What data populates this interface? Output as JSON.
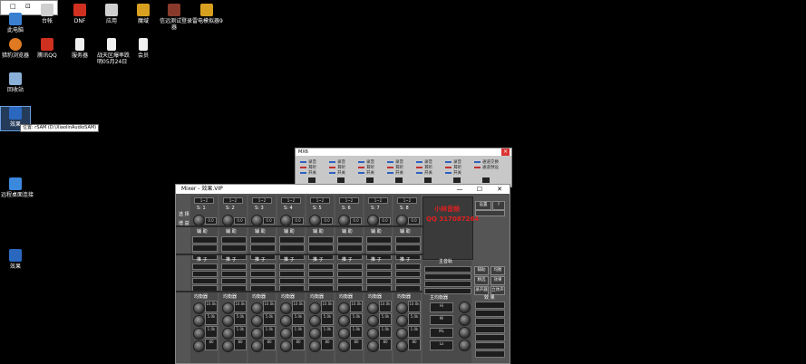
{
  "desktop_icons": [
    {
      "name": "此电脑",
      "line2": ""
    },
    {
      "name": "台帐",
      "line2": ""
    },
    {
      "name": "DNF",
      "line2": ""
    },
    {
      "name": "应用",
      "line2": ""
    },
    {
      "name": "魔域",
      "line2": ""
    },
    {
      "name": "信远测试登录",
      "line2": "器"
    },
    {
      "name": "雷电模拟器9",
      "line2": ""
    },
    {
      "name": "猎豹浏览器",
      "line2": ""
    },
    {
      "name": "腾讯QQ",
      "line2": ""
    },
    {
      "name": "服务器",
      "line2": ""
    },
    {
      "name": "战天区爆率跌",
      "line2": "明05月24日"
    },
    {
      "name": "会员",
      "line2": ""
    },
    {
      "name": "回收站",
      "line2": ""
    },
    {
      "name": "效果",
      "line2": ""
    },
    {
      "name": "远程桌面连接",
      "line2": ""
    },
    {
      "name": "效果",
      "line2": ""
    }
  ],
  "tooltip": "位置: rSAM (D:\\XiaolinAudioSAM)",
  "explorer_buttons": [
    "□",
    "⊡",
    "□"
  ],
  "mx6": {
    "title": "MX6",
    "close": "×",
    "items": [
      [
        "录音",
        "耳听",
        "开关"
      ],
      [
        "录音",
        "耳听",
        "开关"
      ],
      [
        "录音",
        "耳听",
        "开关"
      ],
      [
        "录音",
        "耳听",
        "开关"
      ],
      [
        "录音",
        "耳听",
        "开关"
      ],
      [
        "录音",
        "耳听",
        "开关"
      ],
      [
        "通道交换",
        "通道预设",
        ""
      ]
    ]
  },
  "mixer": {
    "title": "Mixer - 效果.VIP",
    "minimize": "—",
    "maximize": "☐",
    "close": "✕",
    "row_labels": [
      "选 择",
      "增 益"
    ],
    "channels": [
      "S: 1",
      "S: 2",
      "S: 3",
      "S: 4",
      "S: 5",
      "S: 6",
      "S: 7",
      "S: 8"
    ],
    "gain_value": "0.0",
    "aux_label": "辅 助",
    "comp_label": "推 子",
    "eq_label": "均衡器",
    "master_eq": "主均衡器",
    "master_label": "主音轨",
    "effects_label": "效 果",
    "brand_line1": "小林音频",
    "brand_line2": "QQ 317087264",
    "settings": "设置",
    "help": "?",
    "side_buttons": [
      "辅助",
      "均衡",
      "精选",
      "效果",
      "录声器",
      "立体声"
    ],
    "eq_bands": [
      "Hi",
      "Mi",
      "ML",
      "Lo"
    ],
    "eq_band_vals": [
      "10.0k",
      "5.0k",
      "1.0k",
      "80"
    ],
    "select_chip": "1~2"
  }
}
